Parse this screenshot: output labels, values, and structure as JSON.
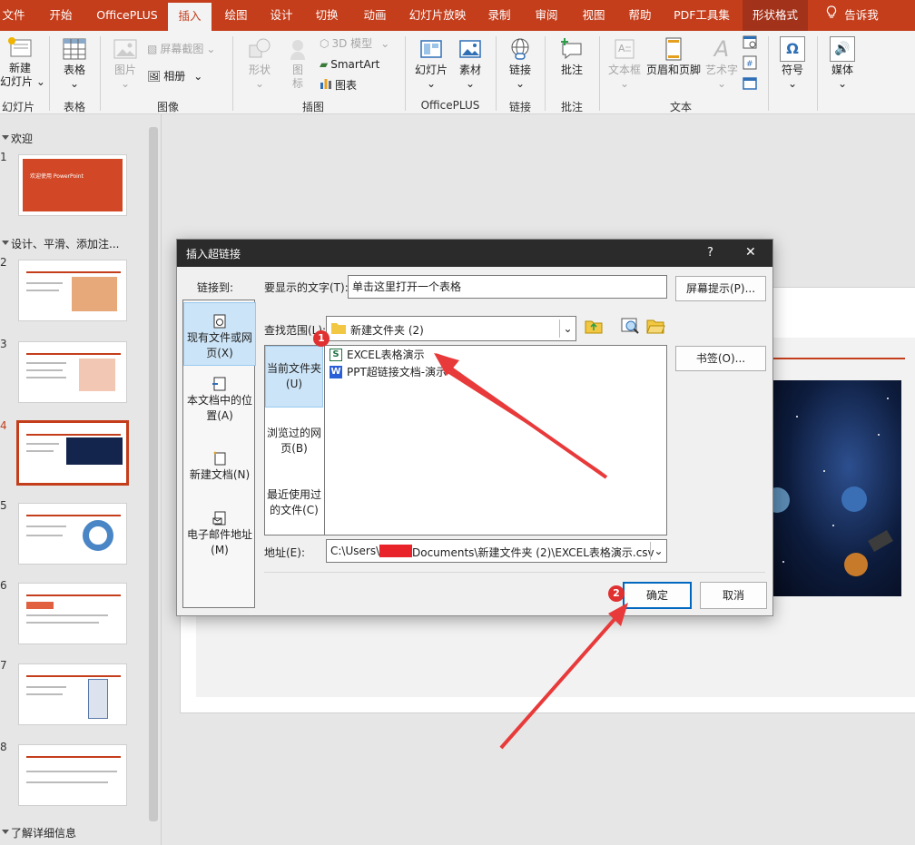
{
  "ribbon_tabs": [
    "文件",
    "开始",
    "OfficePLUS",
    "插入",
    "绘图",
    "设计",
    "切换",
    "动画",
    "幻灯片放映",
    "录制",
    "审阅",
    "视图",
    "帮助",
    "PDF工具集",
    "形状格式",
    "告诉我"
  ],
  "ribbon": {
    "new_slide": "新建",
    "new_slide2": "幻灯片",
    "table": "表格",
    "picture": "图片",
    "screenshot": "屏幕截图",
    "album": "相册",
    "shapes": "形状",
    "icons": "图",
    "icons2": "标",
    "model3d": "3D 模型",
    "smartart": "SmartArt",
    "chart": "图表",
    "slides": "幻灯片",
    "material": "素材",
    "link": "链接",
    "comment": "批注",
    "textbox": "文本框",
    "header_footer": "页眉和页脚",
    "wordart": "艺术字",
    "symbol": "符号",
    "media": "媒体",
    "groups": {
      "slides": "幻灯片",
      "tables": "表格",
      "images": "图像",
      "illustrations": "插图",
      "officeplus": "OfficePLUS",
      "links": "链接",
      "comments": "批注",
      "text": "文本"
    }
  },
  "thumbnails": {
    "sections": [
      "欢迎",
      "设计、平滑、添加注...",
      "了解详细信息"
    ],
    "slide1_title": "欢迎使用 PowerPoint",
    "slide_numbers": [
      "1",
      "2",
      "3",
      "4",
      "5",
      "6",
      "7",
      "8"
    ],
    "current_slide": "4"
  },
  "dialog": {
    "title": "插入超链接",
    "help": "?",
    "close": "✕",
    "link_to_label": "链接到:",
    "link_to_items": [
      "现有文件或网页(X)",
      "本文档中的位置(A)",
      "新建文档(N)",
      "电子邮件地址(M)"
    ],
    "display_text_label": "要显示的文字(T):",
    "display_text_value": "单击这里打开一个表格",
    "screentip_button": "屏幕提示(P)...",
    "look_in_label": "查找范围(L):",
    "look_in_value": "新建文件夹 (2)",
    "look_in_items": [
      "当前文件夹(U)",
      "浏览过的网页(B)",
      "最近使用过的文件(C)"
    ],
    "files": [
      {
        "icon": "S",
        "name": "EXCEL表格演示"
      },
      {
        "icon": "W",
        "name": "PPT超链接文档-演示"
      }
    ],
    "bookmark_button": "书签(O)...",
    "address_label": "地址(E):",
    "address_value_before": "C:\\Users\\",
    "address_value_after": "Documents\\新建文件夹 (2)\\EXCEL表格演示.csv",
    "ok": "确定",
    "cancel": "取消"
  },
  "annotations": {
    "step1": "1",
    "step2": "2"
  },
  "colors": {
    "accent": "#c43e1c",
    "selection": "#cce4f7",
    "annotation": "#e83a3a"
  }
}
